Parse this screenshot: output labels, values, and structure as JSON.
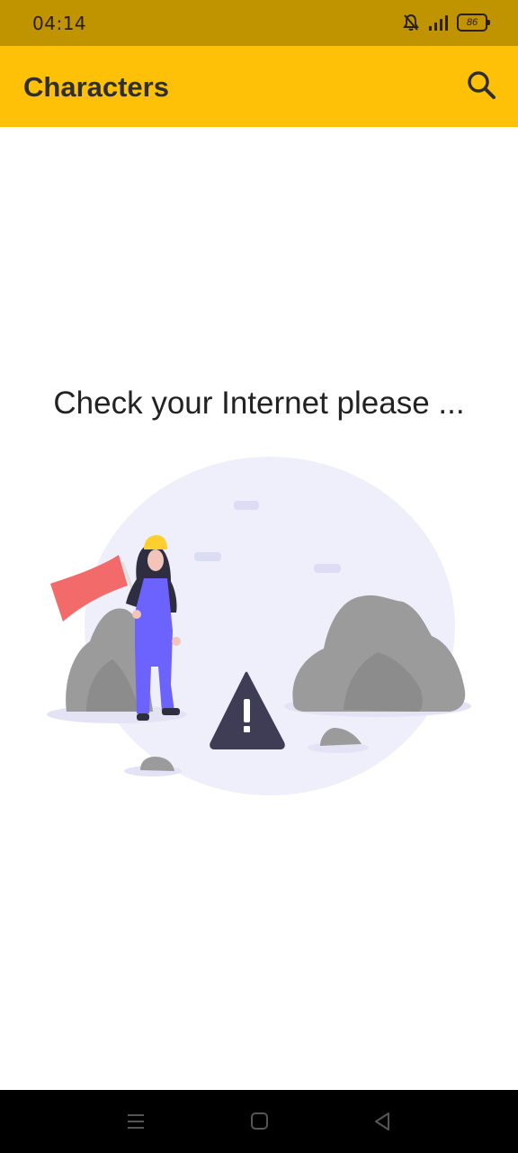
{
  "status_bar": {
    "time": "04:14",
    "battery": "86",
    "icons": [
      "bell-off-icon",
      "signal-icon",
      "battery-icon"
    ]
  },
  "app_bar": {
    "title": "Characters",
    "search_icon": "search-icon",
    "color": "#ffc107"
  },
  "main": {
    "message": "Check your Internet please ...",
    "illustration": "no-internet-illustration"
  },
  "nav_bar": {
    "buttons": [
      "menu-icon",
      "home-icon",
      "back-icon"
    ]
  },
  "colors": {
    "status_bar": "#bf9400",
    "accent": "#ffc107",
    "flag": "#f26a6a",
    "overalls": "#6c63ff",
    "rock": "#9b9b9b",
    "circle": "#efeffc"
  }
}
